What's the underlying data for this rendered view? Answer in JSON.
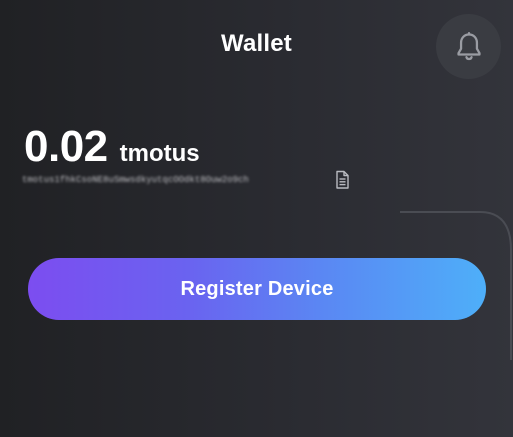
{
  "header": {
    "title": "Wallet",
    "notification_icon": "bell-icon"
  },
  "balance": {
    "amount": "0.02",
    "unit": "tmotus"
  },
  "address": {
    "value": "tmotus1fhkCsoNE8uSmwsdkyutqcOOdkt8Ouw2o9ch",
    "copy_icon": "copy-icon"
  },
  "actions": {
    "register_label": "Register Device"
  },
  "colors": {
    "background": "#25262b",
    "bell_button_bg": "#3a3c42",
    "gradient_start": "#7c4df0",
    "gradient_end": "#4eaff9"
  }
}
